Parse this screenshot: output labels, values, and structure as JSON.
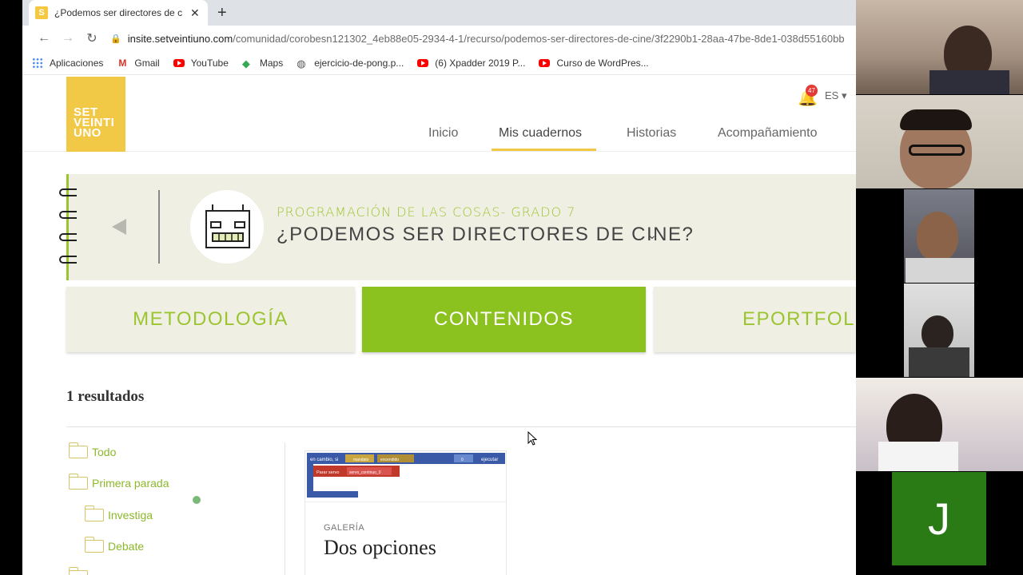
{
  "browser": {
    "tab_title": "¿Podemos ser directores de cine",
    "tab_favicon": "S",
    "url_host": "insite.setveintiuno.com",
    "url_path": "/comunidad/corobesn121302_4eb88e05-2934-4-1/recurso/podemos-ser-directores-de-cine/3f2290b1-28aa-47be-8de1-038d55160bb",
    "bookmarks": [
      {
        "label": "Aplicaciones",
        "icon": "apps-grid-icon"
      },
      {
        "label": "Gmail",
        "icon": "gmail-icon"
      },
      {
        "label": "YouTube",
        "icon": "youtube-icon"
      },
      {
        "label": "Maps",
        "icon": "maps-icon"
      },
      {
        "label": "ejercicio-de-pong.p...",
        "icon": "globe-icon"
      },
      {
        "label": "(6) Xpadder 2019 P...",
        "icon": "youtube-icon"
      },
      {
        "label": "Curso de WordPres...",
        "icon": "youtube-icon"
      }
    ]
  },
  "site": {
    "logo_lines": [
      "SET",
      "VEINTI",
      "UNO"
    ],
    "notification_count": "47",
    "language": "ES ▾",
    "nav": [
      "Inicio",
      "Mis cuadernos",
      "Historias",
      "Acompañamiento"
    ],
    "nav_active": "Mis cuadernos",
    "notebook": {
      "subject": "PROGRAMACIÓN DE LAS COSAS- GRADO 7",
      "title": "¿PODEMOS SER DIRECTORES DE CINE?"
    },
    "sections": [
      "METODOLOGÍA",
      "CONTENIDOS",
      "EPORTFOLIO"
    ],
    "active_section": "CONTENIDOS",
    "results_label": "1 resultados",
    "folders": [
      "Todo",
      "Primera parada",
      "Investiga",
      "Debate"
    ],
    "card": {
      "tag": "GALERÍA",
      "title": "Dos opciones",
      "thumb_blocks": [
        "en cambio, si",
        "mandato",
        "encendido",
        "0",
        "ejecutar",
        "Parar servo",
        "servo_continuo_0"
      ]
    }
  },
  "video_call": {
    "participant_initial": "J",
    "tile_color": "#2a7a16"
  },
  "colors": {
    "brand_yellow": "#f1c947",
    "brand_green": "#8cc21f",
    "banner_bg": "#f0efe4"
  }
}
